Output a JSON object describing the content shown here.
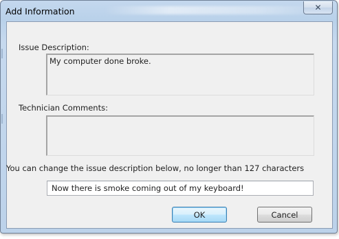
{
  "window": {
    "title": "Add Information",
    "close_glyph": "✕"
  },
  "form": {
    "issue_label": "Issue Description:",
    "issue_value": "My computer done broke.",
    "tech_label": "Technician Comments:",
    "tech_value": "",
    "change_label": "You can change the issue description below, no longer than 127 characters",
    "change_value": "Now there is smoke coming out of my keyboard!"
  },
  "buttons": {
    "ok_label": "OK",
    "cancel_label": "Cancel"
  },
  "icons": {
    "close": "close-icon"
  },
  "colors": {
    "frame": "#b9d1ea",
    "client": "#f0f0f0",
    "default_button_border": "#3c7fb1"
  }
}
